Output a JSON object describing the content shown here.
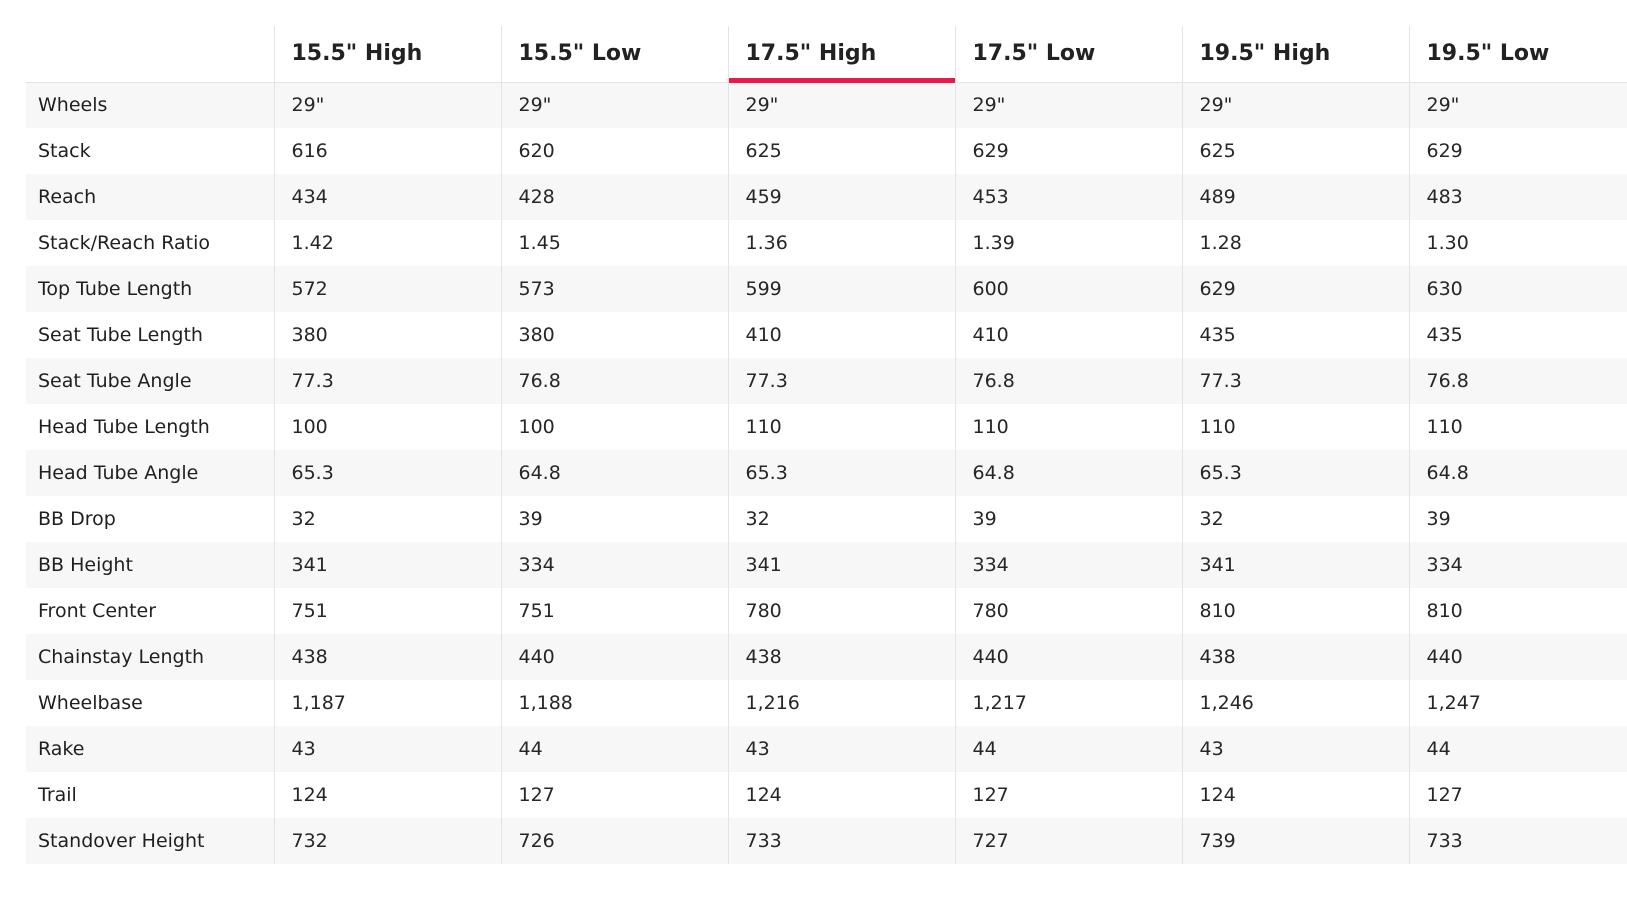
{
  "accent_color": "#e8194b",
  "columns": [
    "15.5\" High",
    "15.5\" Low",
    "17.5\" High",
    "17.5\" Low",
    "19.5\" High",
    "19.5\" Low"
  ],
  "active_column": 2,
  "rows": [
    {
      "label": "Wheels",
      "values": [
        "29\"",
        "29\"",
        "29\"",
        "29\"",
        "29\"",
        "29\""
      ]
    },
    {
      "label": "Stack",
      "values": [
        "616",
        "620",
        "625",
        "629",
        "625",
        "629"
      ]
    },
    {
      "label": "Reach",
      "values": [
        "434",
        "428",
        "459",
        "453",
        "489",
        "483"
      ]
    },
    {
      "label": "Stack/Reach Ratio",
      "values": [
        "1.42",
        "1.45",
        "1.36",
        "1.39",
        "1.28",
        "1.30"
      ]
    },
    {
      "label": "Top Tube Length",
      "values": [
        "572",
        "573",
        "599",
        "600",
        "629",
        "630"
      ]
    },
    {
      "label": "Seat Tube Length",
      "values": [
        "380",
        "380",
        "410",
        "410",
        "435",
        "435"
      ]
    },
    {
      "label": "Seat Tube Angle",
      "values": [
        "77.3",
        "76.8",
        "77.3",
        "76.8",
        "77.3",
        "76.8"
      ]
    },
    {
      "label": "Head Tube Length",
      "values": [
        "100",
        "100",
        "110",
        "110",
        "110",
        "110"
      ]
    },
    {
      "label": "Head Tube Angle",
      "values": [
        "65.3",
        "64.8",
        "65.3",
        "64.8",
        "65.3",
        "64.8"
      ]
    },
    {
      "label": "BB Drop",
      "values": [
        "32",
        "39",
        "32",
        "39",
        "32",
        "39"
      ]
    },
    {
      "label": "BB Height",
      "values": [
        "341",
        "334",
        "341",
        "334",
        "341",
        "334"
      ]
    },
    {
      "label": "Front Center",
      "values": [
        "751",
        "751",
        "780",
        "780",
        "810",
        "810"
      ]
    },
    {
      "label": "Chainstay Length",
      "values": [
        "438",
        "440",
        "438",
        "440",
        "438",
        "440"
      ]
    },
    {
      "label": "Wheelbase",
      "values": [
        "1,187",
        "1,188",
        "1,216",
        "1,217",
        "1,246",
        "1,247"
      ]
    },
    {
      "label": "Rake",
      "values": [
        "43",
        "44",
        "43",
        "44",
        "43",
        "44"
      ]
    },
    {
      "label": "Trail",
      "values": [
        "124",
        "127",
        "124",
        "127",
        "124",
        "127"
      ]
    },
    {
      "label": "Standover Height",
      "values": [
        "732",
        "726",
        "733",
        "727",
        "739",
        "733"
      ]
    }
  ]
}
